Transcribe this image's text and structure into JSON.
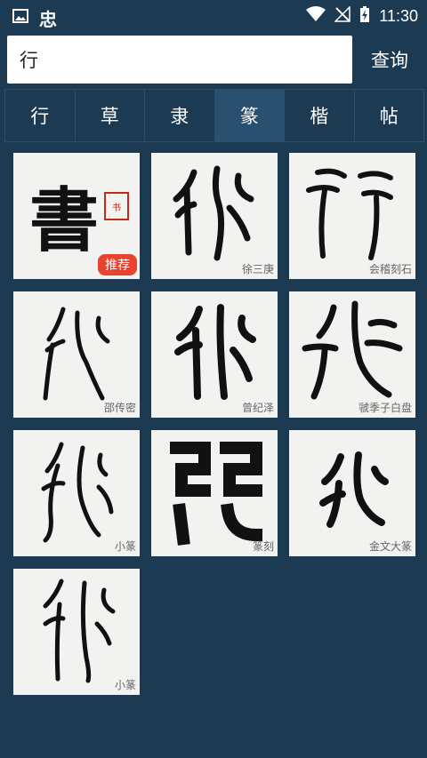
{
  "status": {
    "app_mark": "忠",
    "time": "11:30"
  },
  "search": {
    "value": "行",
    "button_label": "查询"
  },
  "tabs": [
    {
      "label": "行",
      "active": false
    },
    {
      "label": "草",
      "active": false
    },
    {
      "label": "隶",
      "active": false
    },
    {
      "label": "篆",
      "active": true
    },
    {
      "label": "楷",
      "active": false
    },
    {
      "label": "帖",
      "active": false
    }
  ],
  "promo": {
    "glyph": "書",
    "seal_text": "书",
    "badge": "推荐"
  },
  "results": [
    {
      "label": "徐三庚"
    },
    {
      "label": "会稽刻石"
    },
    {
      "label": "邵传密"
    },
    {
      "label": "曾纪泽"
    },
    {
      "label": "虢季子白盘"
    },
    {
      "label": "小篆"
    },
    {
      "label": "篆刻"
    },
    {
      "label": "金文大篆"
    },
    {
      "label": "小篆"
    }
  ]
}
